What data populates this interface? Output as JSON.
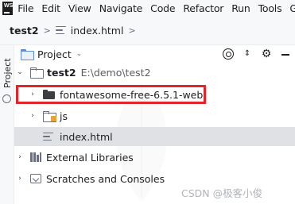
{
  "menubar": {
    "logo": "WS",
    "items": [
      "File",
      "Edit",
      "View",
      "Navigate",
      "Code",
      "Refactor",
      "Run",
      "Tools",
      "G"
    ]
  },
  "breadcrumb": {
    "project": "test2",
    "sep1": ">",
    "file": "index.html",
    "sep2": ">"
  },
  "side_stripe": {
    "label": "Project"
  },
  "project_panel": {
    "title": "Project",
    "chevron": "⌄"
  },
  "tree": {
    "root": {
      "name": "test2",
      "path": "E:\\demo\\test2",
      "arrow": "⌄"
    },
    "items": [
      {
        "name": "fontawesome-free-6.5.1-web",
        "arrow": "›"
      },
      {
        "name": "js",
        "arrow": "›"
      },
      {
        "name": "index.html"
      },
      {
        "name": "External Libraries",
        "arrow": "›"
      },
      {
        "name": "Scratches and Consoles",
        "arrow": "›"
      }
    ]
  },
  "watermark": {
    "text": "CSDN @极客小俊"
  },
  "colors": {
    "highlight": "#e0262b",
    "selection": "#dfe1e5",
    "panel_bg": "#f7f8fa",
    "folder_blue": "#5f8dd3",
    "js_badge": "#e8a33d"
  }
}
